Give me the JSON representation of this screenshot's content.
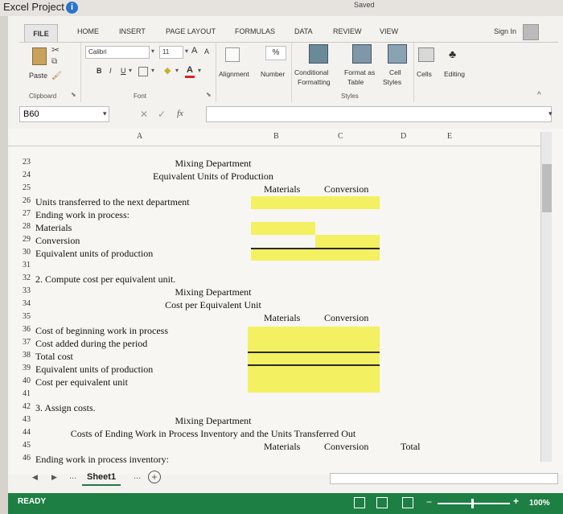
{
  "outer": {
    "title": "Excel Project",
    "info_icon": "i",
    "saved": "Saved"
  },
  "tabs": {
    "file": "FILE",
    "home": "HOME",
    "insert": "INSERT",
    "page_layout": "PAGE LAYOUT",
    "formulas": "FORMULAS",
    "data": "DATA",
    "review": "REVIEW",
    "view": "VIEW",
    "sign_in": "Sign In"
  },
  "ribbon": {
    "paste": "Paste",
    "clipboard": "Clipboard",
    "font_name": "Calibri",
    "font_size": "11",
    "font_grow": "A",
    "font_shrink": "A",
    "bold": "B",
    "italic": "I",
    "underline": "U",
    "font_group": "Font",
    "alignment": "Alignment",
    "number": "Number",
    "percent": "%",
    "conditional_formatting_1": "Conditional",
    "conditional_formatting_2": "Formatting",
    "format_as_table_1": "Format as",
    "format_as_table_2": "Table",
    "cell_styles_1": "Cell",
    "cell_styles_2": "Styles",
    "styles_group": "Styles",
    "cells": "Cells",
    "editing": "Editing"
  },
  "formula_bar": {
    "name_box": "B60",
    "fx": "fx",
    "cancel": "✕",
    "enter": "✓",
    "value": ""
  },
  "columns": [
    "A",
    "B",
    "C",
    "D",
    "E"
  ],
  "rows": [
    {
      "num": "23",
      "a": "",
      "center": "Mixing Department"
    },
    {
      "num": "24",
      "a": "",
      "center": "Equivalent Units of Production"
    },
    {
      "num": "25",
      "a": "",
      "b": "Materials",
      "c": "Conversion"
    },
    {
      "num": "26",
      "a": "Units transferred to the next department"
    },
    {
      "num": "27",
      "a": "Ending work in process:"
    },
    {
      "num": "28",
      "a": "Materials"
    },
    {
      "num": "29",
      "a": "Conversion"
    },
    {
      "num": "30",
      "a": "Equivalent units of production"
    },
    {
      "num": "31",
      "a": ""
    },
    {
      "num": "32",
      "a": "2. Compute cost per equivalent unit."
    },
    {
      "num": "33",
      "a": "",
      "center": "Mixing Department"
    },
    {
      "num": "34",
      "a": "",
      "center": "Cost per Equivalent Unit"
    },
    {
      "num": "35",
      "a": "",
      "b": "Materials",
      "c": "Conversion"
    },
    {
      "num": "36",
      "a": "Cost of beginning work in process"
    },
    {
      "num": "37",
      "a": "Cost added during the period"
    },
    {
      "num": "38",
      "a": "Total cost"
    },
    {
      "num": "39",
      "a": "Equivalent units of production"
    },
    {
      "num": "40",
      "a": "Cost per equivalent unit"
    },
    {
      "num": "41",
      "a": ""
    },
    {
      "num": "42",
      "a": "3. Assign costs."
    },
    {
      "num": "43",
      "a": "",
      "center": "Mixing Department"
    },
    {
      "num": "44",
      "a": "",
      "center": "Costs of Ending Work in Process Inventory and the Units Transferred Out"
    },
    {
      "num": "45",
      "a": "",
      "b": "Materials",
      "c": "Conversion",
      "d": "Total"
    },
    {
      "num": "46",
      "a": "Ending work in process inventory:"
    }
  ],
  "sheets": {
    "active": "Sheet1",
    "more": "..."
  },
  "status": {
    "ready": "READY",
    "zoom": "100%"
  }
}
